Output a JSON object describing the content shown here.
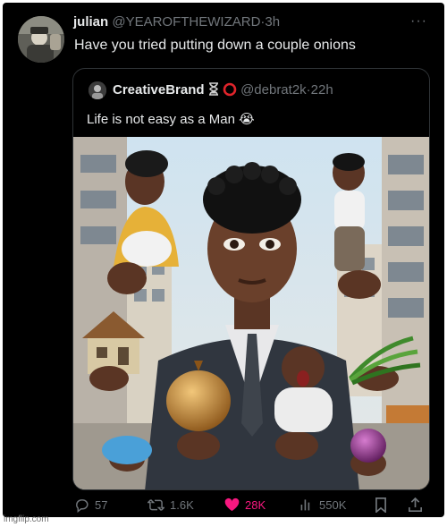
{
  "tweet": {
    "author_name": "julian",
    "author_handle": "@YEAROFTHEWIZARD",
    "separator": "·",
    "time": "3h",
    "more_icon": "more-horizontal-icon",
    "text": "Have you tried putting down a couple onions"
  },
  "quoted": {
    "author_name": "CreativeBrand",
    "badges": [
      "hourglass-icon",
      "ring-icon"
    ],
    "author_handle": "@debrat2k",
    "separator": "·",
    "time": "22h",
    "text": "Life is not easy as a Man",
    "emoji": "😭"
  },
  "actions": {
    "replies": "57",
    "reposts": "1.6K",
    "likes": "28K",
    "views": "550K",
    "icons": [
      "reply-icon",
      "repost-icon",
      "like-icon",
      "views-icon",
      "bookmark-icon",
      "share-icon"
    ]
  },
  "colors": {
    "background": "#000000",
    "text_primary": "#e7e9ea",
    "text_secondary": "#71767b",
    "like": "#f91880",
    "border": "#2f3336"
  },
  "watermark": "imgflip.com"
}
